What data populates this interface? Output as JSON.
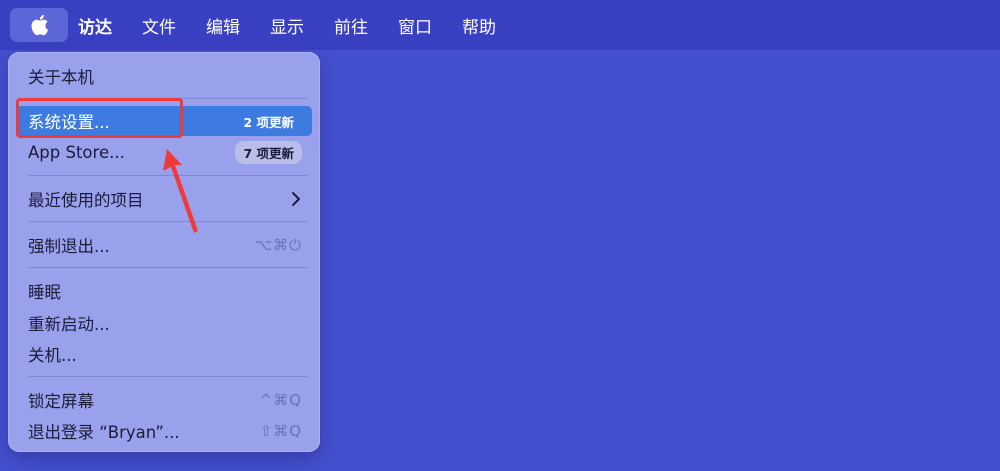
{
  "menubar": {
    "apple_icon": "apple-logo-icon",
    "items": [
      {
        "label": "访达",
        "bold": true
      },
      {
        "label": "文件"
      },
      {
        "label": "编辑"
      },
      {
        "label": "显示"
      },
      {
        "label": "前往"
      },
      {
        "label": "窗口"
      },
      {
        "label": "帮助"
      }
    ]
  },
  "apple_menu": {
    "about": "关于本机",
    "system_settings": {
      "label": "系统设置...",
      "badge": "2 项更新"
    },
    "app_store": {
      "label": "App Store...",
      "badge": "7 项更新"
    },
    "recent_items": {
      "label": "最近使用的项目"
    },
    "force_quit": {
      "label": "强制退出...",
      "shortcut": "⌥⌘⏻"
    },
    "sleep": "睡眠",
    "restart": "重新启动...",
    "shutdown": "关机...",
    "lock_screen": {
      "label": "锁定屏幕",
      "shortcut": "^⌘Q"
    },
    "logout": {
      "label": "退出登录 “Bryan”...",
      "shortcut": "⇧⌘Q"
    }
  },
  "colors": {
    "desktop": "#4550cf",
    "menubar": "#3a40c2",
    "menu_bg": "#9aa1ec",
    "selection": "#3d7be0",
    "annotation": "#ee3a3a"
  }
}
